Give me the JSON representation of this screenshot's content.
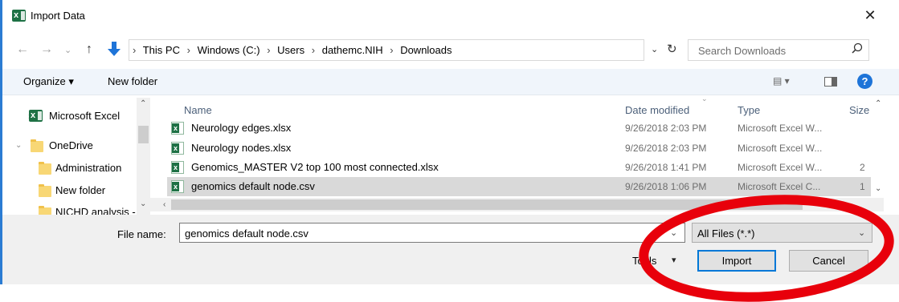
{
  "window": {
    "title": "Import Data",
    "close_glyph": "✕",
    "app_icon": "excel-icon"
  },
  "address_bar": {
    "breadcrumbs": [
      "This PC",
      "Windows (C:)",
      "Users",
      "dathemc.NIH",
      "Downloads"
    ],
    "separator": "›",
    "search_placeholder": "Search Downloads"
  },
  "toolbar": {
    "organize_label": "Organize ▾",
    "new_folder_label": "New folder",
    "view_label": "▤ ▾",
    "help_label": "?"
  },
  "nav_pane": {
    "items": [
      {
        "label": "Microsoft Excel",
        "icon": "excel-icon"
      },
      {
        "label": "OneDrive",
        "icon": "folder-icon"
      },
      {
        "label": "Administration",
        "icon": "folder-icon"
      },
      {
        "label": "New folder",
        "icon": "folder-icon"
      },
      {
        "label": "NICHD analysis -",
        "icon": "folder-icon"
      }
    ]
  },
  "file_list": {
    "columns": {
      "name": "Name",
      "date": "Date modified",
      "type": "Type",
      "size": "Size"
    },
    "rows": [
      {
        "name": "Neurology edges.xlsx",
        "date": "9/26/2018 2:03 PM",
        "type": "Microsoft Excel W...",
        "size": ""
      },
      {
        "name": "Neurology nodes.xlsx",
        "date": "9/26/2018 2:03 PM",
        "type": "Microsoft Excel W...",
        "size": ""
      },
      {
        "name": "Genomics_MASTER V2 top 100 most connected.xlsx",
        "date": "9/26/2018 1:41 PM",
        "type": "Microsoft Excel W...",
        "size": "2"
      },
      {
        "name": "genomics default node.csv",
        "date": "9/26/2018 1:06 PM",
        "type": "Microsoft Excel C...",
        "size": "1"
      }
    ],
    "selected_index": 3
  },
  "bottom": {
    "file_name_label": "File name:",
    "file_name_value": "genomics default node.csv",
    "filter_value": "All Files (*.*)",
    "tools_label": "Tools",
    "import_label": "Import",
    "cancel_label": "Cancel"
  },
  "colors": {
    "accent": "#0078d7",
    "annotation_red": "#e8000b",
    "selected_row": "#d9d9d9",
    "excel_green": "#1e7145"
  }
}
